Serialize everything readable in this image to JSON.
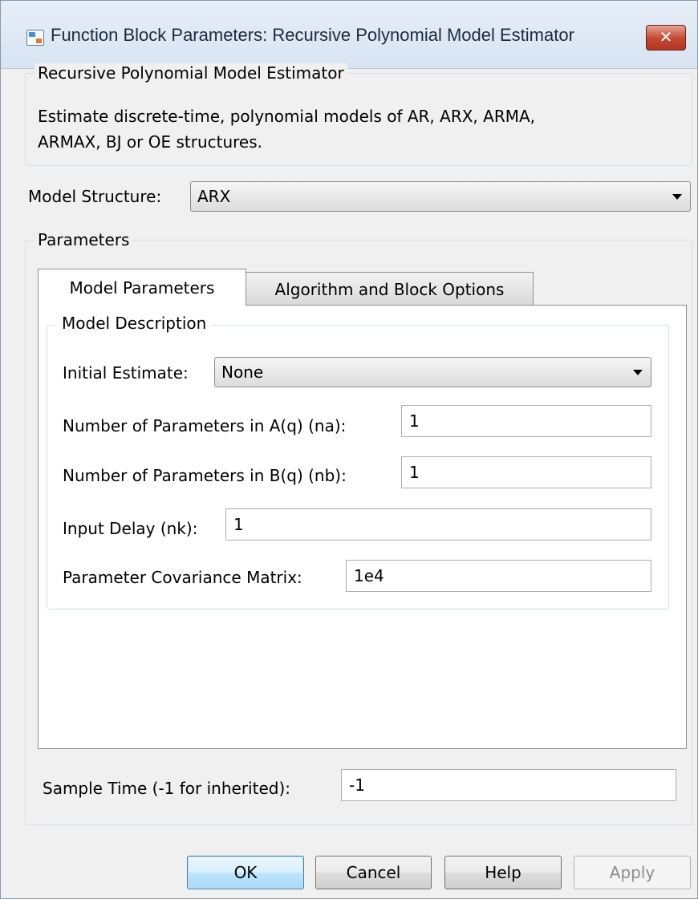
{
  "window": {
    "title": "Function Block Parameters: Recursive Polynomial Model Estimator",
    "close_glyph": "✕"
  },
  "block": {
    "group_title": "Recursive Polynomial Model Estimator",
    "description_line1": "Estimate discrete-time, polynomial models of AR, ARX, ARMA,",
    "description_line2": "ARMAX, BJ or OE structures."
  },
  "model_structure": {
    "label": "Model Structure:",
    "value": "ARX"
  },
  "parameters": {
    "group_title": "Parameters",
    "tabs": [
      {
        "label": "Model Parameters",
        "active": true
      },
      {
        "label": "Algorithm and Block Options",
        "active": false
      }
    ],
    "model_description": {
      "title": "Model Description",
      "initial_estimate": {
        "label": "Initial Estimate:",
        "value": "None"
      },
      "na": {
        "label": "Number of Parameters in A(q) (na):",
        "value": "1"
      },
      "nb": {
        "label": "Number of Parameters in B(q) (nb):",
        "value": "1"
      },
      "nk": {
        "label": "Input Delay (nk):",
        "value": "1"
      },
      "covariance": {
        "label": "Parameter Covariance Matrix:",
        "value": "1e4"
      }
    }
  },
  "sample_time": {
    "label": "Sample Time (-1 for inherited):",
    "value": "-1"
  },
  "buttons": {
    "ok": "OK",
    "cancel": "Cancel",
    "help": "Help",
    "apply": "Apply"
  },
  "colors": {
    "title_bar": "#dfe8f5",
    "close_button": "#c2462f",
    "default_button": "#bee6fd"
  }
}
